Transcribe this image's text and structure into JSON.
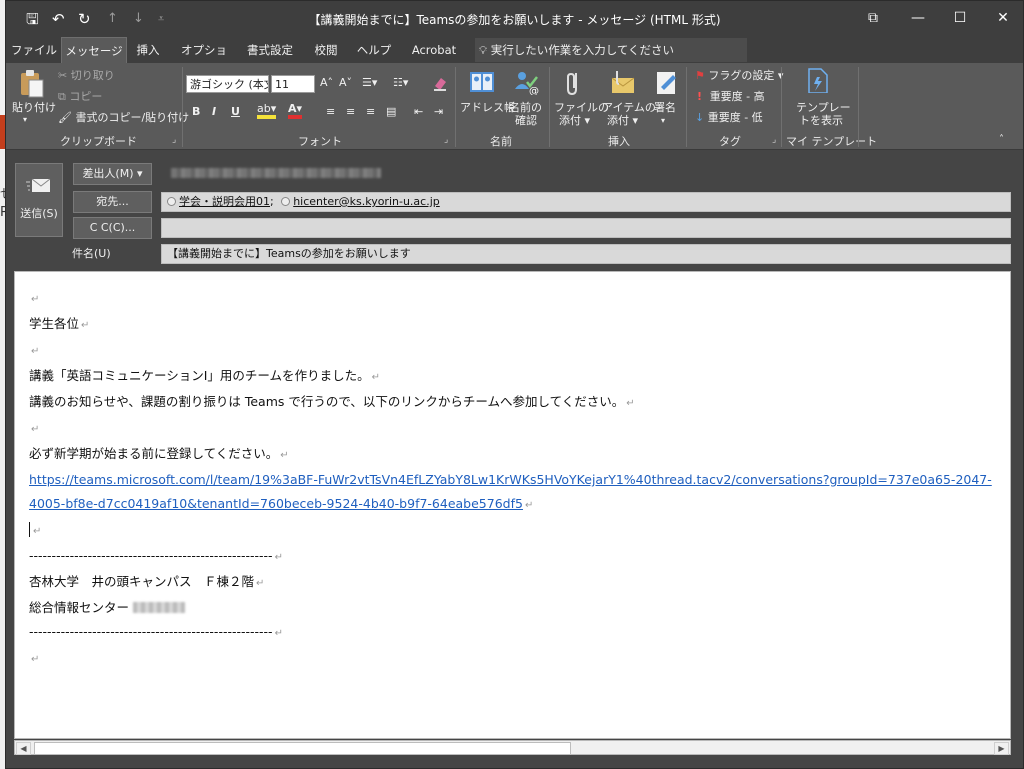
{
  "window": {
    "title": "【講義開始までに】Teamsの参加をお願いします  -  メッセージ (HTML 形式)",
    "qat": {
      "save": "🖫",
      "undo": "↶",
      "redo": "↻",
      "up": "↑",
      "down": "↓",
      "customize": "⩡"
    },
    "buttons": {
      "ribbon_display": "⧉",
      "minimize": "—",
      "maximize": "☐",
      "close": "✕"
    }
  },
  "tabs": [
    "ファイル",
    "メッセージ",
    "挿入",
    "オプション",
    "書式設定",
    "校閲",
    "ヘルプ",
    "Acrobat"
  ],
  "tell_me": "実行したい作業を入力してください",
  "ribbon": {
    "clipboard": {
      "paste": "貼り付け",
      "cut": "切り取り",
      "copy": "コピー",
      "format_painter": "書式のコピー/貼り付け",
      "group": "クリップボード"
    },
    "font": {
      "family": "游ゴシック (本文",
      "size": "11",
      "bold": "B",
      "italic": "I",
      "underline": "U",
      "group": "フォント"
    },
    "names": {
      "address_book": "アドレス帳",
      "check_names_1": "名前の",
      "check_names_2": "確認",
      "group": "名前"
    },
    "include": {
      "attach_file_1": "ファイルの",
      "attach_file_2": "添付",
      "attach_item_1": "アイテムの",
      "attach_item_2": "添付",
      "signature": "署名",
      "group": "挿入"
    },
    "tags": {
      "followup": "フラグの設定",
      "high": "重要度 - 高",
      "low": "重要度 - 低",
      "group": "タグ"
    },
    "templates": {
      "view_1": "テンプレー",
      "view_2": "トを表示",
      "group": "マイ テンプレート"
    }
  },
  "header": {
    "send": "送信(S)",
    "from": "差出人(M)",
    "to_btn": "宛先...",
    "cc_btn": "C C(C)...",
    "subject_label": "件名(U)",
    "to_recipients": [
      "学会・説明会用01",
      "hicenter@ks.kyorin-u.ac.jp"
    ],
    "subject": "【講義開始までに】Teamsの参加をお願いします"
  },
  "body": {
    "p_salutation": "学生各位",
    "p_line1": "講義「英語コミュニケーションⅠ」用のチームを作りました。",
    "p_line2": "講義のお知らせや、課題の割り振りは Teams で行うので、以下のリンクからチームへ参加してください。",
    "p_line3": "必ず新学期が始まる前に登録してください。",
    "link": "https://teams.microsoft.com/l/team/19%3aBF-FuWr2vtTsVn4EfLZYabY8Lw1KrWKs5HVoYKejarY1%40thread.tacv2/conversations?groupId=737e0a65-2047-4005-bf8e-d7cc0419af10&tenantId=760beceb-9524-4b40-b9f7-64eabe576df5",
    "separator": "------------------------------------------------------",
    "sig1": "杏林大学　井の頭キャンパス　Ｆ棟２階",
    "sig2": "総合情報センター",
    "pmark": "↵"
  },
  "backdrop": {
    "red_glyph": "台",
    "chars": "せ P"
  }
}
